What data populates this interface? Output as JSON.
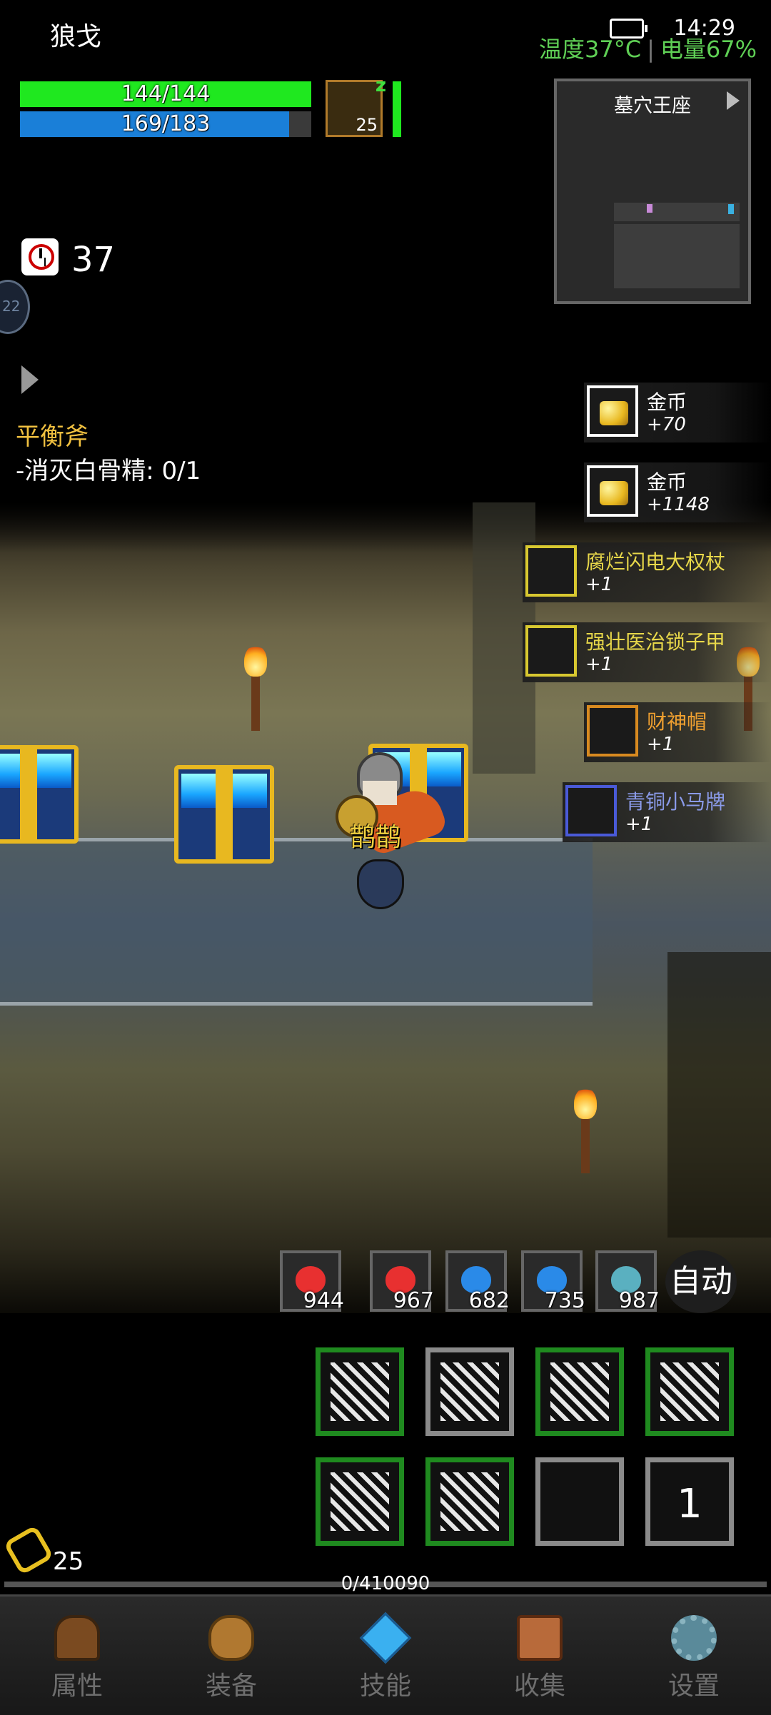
{
  "status": {
    "player_name": "狼戈",
    "time": "14:29",
    "temperature": "温度37°C",
    "battery": "电量67%"
  },
  "hp": {
    "text": "144/144",
    "fraction": 1.0
  },
  "mp": {
    "text": "169/183",
    "fraction": 0.9235
  },
  "pet": {
    "level": "25",
    "sleep": "z"
  },
  "minimap": {
    "title": "墓穴王座"
  },
  "timer": {
    "value": "37"
  },
  "side_badge": {
    "label": "22"
  },
  "quest": {
    "title": "平衡斧",
    "task": "-消灭白骨精: 0/1"
  },
  "hero": {
    "name": "鹊鹊"
  },
  "loot": [
    {
      "name": "金币",
      "count": "+70",
      "color": "#ffffff",
      "icon": "gold-coin-icon"
    },
    {
      "name": "金币",
      "count": "+1148",
      "color": "#ffffff",
      "icon": "gold-coin-icon"
    },
    {
      "name": "腐烂闪电大权杖",
      "count": "+1",
      "color": "#e8d84a",
      "icon": "scepter-icon"
    },
    {
      "name": "强壮医治锁子甲",
      "count": "+1",
      "color": "#e8d84a",
      "icon": "chainmail-icon"
    },
    {
      "name": "财神帽",
      "count": "+1",
      "color": "#f0a030",
      "icon": "hat-icon"
    },
    {
      "name": "青铜小马牌",
      "count": "+1",
      "color": "#8a9ae8",
      "icon": "badge-icon"
    }
  ],
  "potions": [
    {
      "count": "944",
      "color": "#e83030",
      "icon": "red-potion-icon"
    },
    {
      "count": "967",
      "color": "#e83030",
      "icon": "red-potion-icon"
    },
    {
      "count": "682",
      "color": "#2a8ae8",
      "icon": "blue-potion-icon"
    },
    {
      "count": "735",
      "color": "#2a8ae8",
      "icon": "blue-potion-icon"
    },
    {
      "count": "987",
      "color": "#5ab0c0",
      "icon": "fish-icon"
    }
  ],
  "auto_label": "自动",
  "skills": {
    "slot_number": "1"
  },
  "chain": {
    "count": "25"
  },
  "xp": {
    "text": "0/410090"
  },
  "nav": [
    {
      "label": "属性",
      "icon": "helmet-icon"
    },
    {
      "label": "装备",
      "icon": "bag-icon"
    },
    {
      "label": "技能",
      "icon": "gem-icon"
    },
    {
      "label": "收集",
      "icon": "book-icon"
    },
    {
      "label": "设置",
      "icon": "gear-icon"
    }
  ]
}
